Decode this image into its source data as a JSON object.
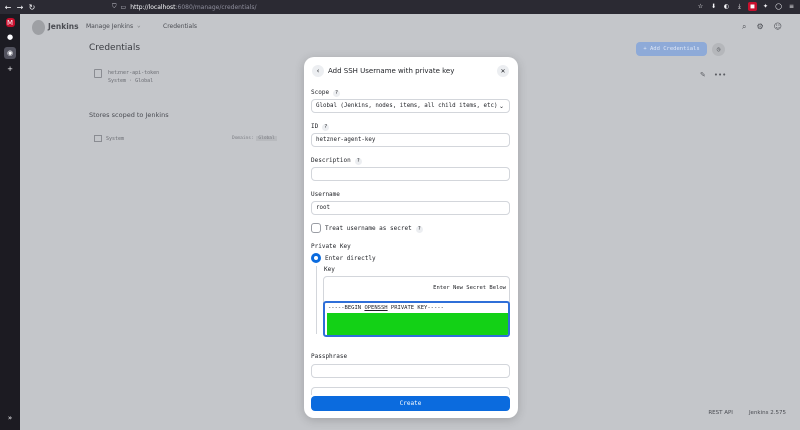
{
  "browser": {
    "url_host": "localhost",
    "url_port_path": ":6080/manage/credentials/"
  },
  "jenkins": {
    "brand": "Jenkins",
    "breadcrumb_1": "Manage Jenkins",
    "breadcrumb_2": "Credentials",
    "page_title": "Credentials",
    "add_button": "+ Add Credentials",
    "credential_name": "hetzner-api-token",
    "credential_sub": "System · Global",
    "stores_title": "Stores scoped to Jenkins",
    "store_name": "System",
    "domains_label": "Domains:",
    "domain_badge": "Global",
    "footer_api": "REST API",
    "footer_version": "Jenkins 2.575"
  },
  "modal": {
    "title": "Add SSH Username with private key",
    "scope_label": "Scope",
    "scope_value": "Global (Jenkins, nodes, items, all child items, etc)",
    "id_label": "ID",
    "id_value": "hetzner-agent-key",
    "description_label": "Description",
    "description_value": "",
    "username_label": "Username",
    "username_value": "root",
    "treat_secret_label": "Treat username as secret",
    "private_key_label": "Private Key",
    "enter_directly_label": "Enter directly",
    "key_label": "Key",
    "key_note": "Enter New Secret Below",
    "key_first_line_a": "-----BEGIN ",
    "key_first_line_u": "OPENSSH",
    "key_first_line_b": " PRIVATE KEY-----",
    "passphrase_label": "Passphrase",
    "create_button": "Create"
  }
}
